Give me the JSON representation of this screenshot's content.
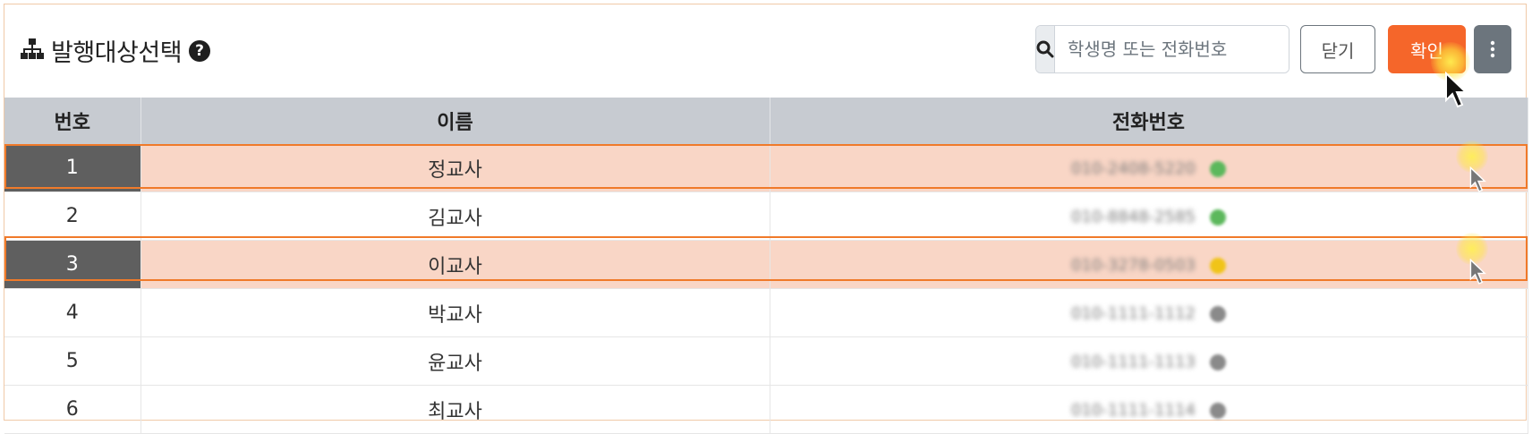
{
  "header": {
    "title": "발행대상선택",
    "help_icon": "question-circle-icon",
    "title_icon": "sitemap-icon"
  },
  "search": {
    "placeholder": "학생명 또는 전화번호",
    "icon": "search-icon"
  },
  "buttons": {
    "close_label": "닫기",
    "confirm_label": "확인",
    "more_icon": "vertical-dots-icon"
  },
  "table": {
    "columns": [
      "번호",
      "이름",
      "전화번호"
    ],
    "rows": [
      {
        "num": "1",
        "name": "정교사",
        "phone": "010-2408-5220",
        "status": "green",
        "selected": true
      },
      {
        "num": "2",
        "name": "김교사",
        "phone": "010-8848-2585",
        "status": "green",
        "selected": false
      },
      {
        "num": "3",
        "name": "이교사",
        "phone": "010-3278-0503",
        "status": "yellow",
        "selected": true
      },
      {
        "num": "4",
        "name": "박교사",
        "phone": "010-1111-1112",
        "status": "gray",
        "selected": false
      },
      {
        "num": "5",
        "name": "윤교사",
        "phone": "010-1111-1113",
        "status": "gray",
        "selected": false
      },
      {
        "num": "6",
        "name": "최교사",
        "phone": "010-1111-1114",
        "status": "gray",
        "selected": false
      }
    ]
  },
  "colors": {
    "accent": "#f5662a",
    "selected_row": "#f9d6c6",
    "selected_outline": "#f07a2a",
    "status_green": "#5cb85c",
    "status_yellow": "#f0c419",
    "status_gray": "#8a8a8a"
  }
}
